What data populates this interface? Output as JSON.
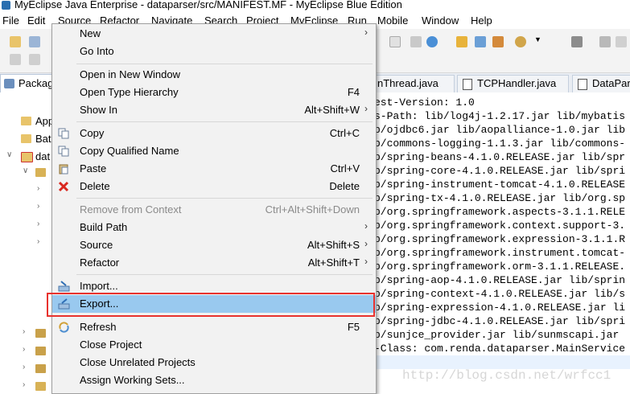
{
  "window": {
    "title": "MyEclipse Java Enterprise - dataparser/src/MANIFEST.MF - MyEclipse Blue Edition"
  },
  "menubar": {
    "items": [
      "File",
      "Edit",
      "Source",
      "Refactor",
      "Navigate",
      "Search",
      "Project",
      "MyEclipse",
      "Run",
      "Mobile",
      "Window",
      "Help"
    ]
  },
  "views": {
    "package_explorer_tab": "Packag"
  },
  "editor_tabs": [
    {
      "label": "nThread.java"
    },
    {
      "label": "TCPHandler.java"
    },
    {
      "label": "DataPar"
    }
  ],
  "tree": {
    "items": [
      {
        "label": "App"
      },
      {
        "label": "Bat"
      },
      {
        "label": "dat"
      }
    ]
  },
  "editor": {
    "lines": [
      "est-Version: 1.0",
      "s-Path: lib/log4j-1.2.17.jar lib/mybatis",
      "b/ojdbc6.jar lib/aopalliance-1.0.jar lib",
      "b/commons-logging-1.1.3.jar lib/commons-",
      "b/spring-beans-4.1.0.RELEASE.jar lib/spr",
      "b/spring-core-4.1.0.RELEASE.jar lib/spri",
      "b/spring-instrument-tomcat-4.1.0.RELEASE",
      "b/spring-tx-4.1.0.RELEASE.jar lib/org.sp",
      "b/org.springframework.aspects-3.1.1.RELE",
      "b/org.springframework.context.support-3.",
      "b/org.springframework.expression-3.1.1.R",
      "b/org.springframework.instrument.tomcat-",
      "b/org.springframework.orm-3.1.1.RELEASE.",
      "b/spring-aop-4.1.0.RELEASE.jar lib/sprin",
      "b/spring-context-4.1.0.RELEASE.jar lib/s",
      "b/spring-expression-4.1.0.RELEASE.jar li",
      "b/spring-jdbc-4.1.0.RELEASE.jar lib/spri",
      "b/sunjce_provider.jar lib/sunmscapi.jar",
      "-Class: com.renda.dataparser.MainService"
    ],
    "watermark": "http://blog.csdn.net/wrfcc1"
  },
  "context_menu": {
    "items": [
      {
        "id": "new",
        "label": "New",
        "shortcut": "",
        "submenu": true,
        "icon": "none"
      },
      {
        "id": "go-into",
        "label": "Go Into",
        "shortcut": "",
        "submenu": false,
        "icon": "none"
      },
      {
        "id": "open-in-new-window",
        "label": "Open in New Window",
        "shortcut": "",
        "submenu": false,
        "icon": "none"
      },
      {
        "id": "open-type-hierarchy",
        "label": "Open Type Hierarchy",
        "shortcut": "F4",
        "submenu": false,
        "icon": "none"
      },
      {
        "id": "show-in",
        "label": "Show In",
        "shortcut": "Alt+Shift+W",
        "submenu": true,
        "icon": "none"
      },
      {
        "id": "copy",
        "label": "Copy",
        "shortcut": "Ctrl+C",
        "submenu": false,
        "icon": "copy-icon"
      },
      {
        "id": "copy-qualified-name",
        "label": "Copy Qualified Name",
        "shortcut": "",
        "submenu": false,
        "icon": "copy-icon"
      },
      {
        "id": "paste",
        "label": "Paste",
        "shortcut": "Ctrl+V",
        "submenu": false,
        "icon": "paste-icon"
      },
      {
        "id": "delete",
        "label": "Delete",
        "shortcut": "Delete",
        "submenu": false,
        "icon": "delete-icon"
      },
      {
        "id": "remove-from-context",
        "label": "Remove from Context",
        "shortcut": "Ctrl+Alt+Shift+Down",
        "submenu": false,
        "icon": "none",
        "disabled": true
      },
      {
        "id": "build-path",
        "label": "Build Path",
        "shortcut": "",
        "submenu": true,
        "icon": "none"
      },
      {
        "id": "source",
        "label": "Source",
        "shortcut": "Alt+Shift+S",
        "submenu": true,
        "icon": "none"
      },
      {
        "id": "refactor",
        "label": "Refactor",
        "shortcut": "Alt+Shift+T",
        "submenu": true,
        "icon": "none"
      },
      {
        "id": "import",
        "label": "Import...",
        "shortcut": "",
        "submenu": false,
        "icon": "import-icon"
      },
      {
        "id": "export",
        "label": "Export...",
        "shortcut": "",
        "submenu": false,
        "icon": "export-icon",
        "selected": true
      },
      {
        "id": "refresh",
        "label": "Refresh",
        "shortcut": "F5",
        "submenu": false,
        "icon": "refresh-icon"
      },
      {
        "id": "close-project",
        "label": "Close Project",
        "shortcut": "",
        "submenu": false,
        "icon": "none"
      },
      {
        "id": "close-unrelated-projects",
        "label": "Close Unrelated Projects",
        "shortcut": "",
        "submenu": false,
        "icon": "none"
      },
      {
        "id": "assign-working-sets",
        "label": "Assign Working Sets...",
        "shortcut": "",
        "submenu": false,
        "icon": "none"
      }
    ]
  },
  "colors": {
    "selection": "#99c9ef",
    "highlight_box": "#e8322e"
  }
}
